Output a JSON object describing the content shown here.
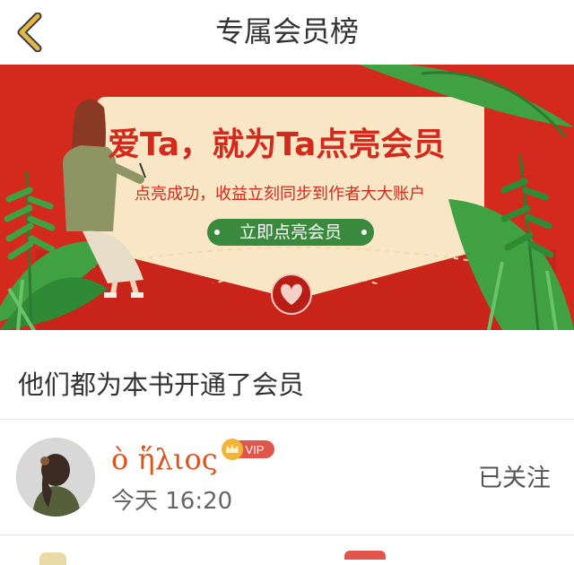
{
  "header": {
    "title": "专属会员榜",
    "back_icon": "chevron-left-icon",
    "accent": "#e0b84a"
  },
  "banner": {
    "headline": "爱Ta，就为Ta点亮会员",
    "subline": "点亮成功，收益立刻同步到作者大大账户",
    "cta_label": "立即点亮会员",
    "colors": {
      "red": "#d42a1e",
      "card": "#f9e6c4",
      "green": "#3fa142",
      "cta": "#3a8a3d"
    }
  },
  "section": {
    "title": "他们都为本书开通了会员"
  },
  "members": [
    {
      "name": "ὸ ἥλιος",
      "badge": "VIP",
      "time": "今天 16:20",
      "follow_label": "已关注"
    }
  ]
}
